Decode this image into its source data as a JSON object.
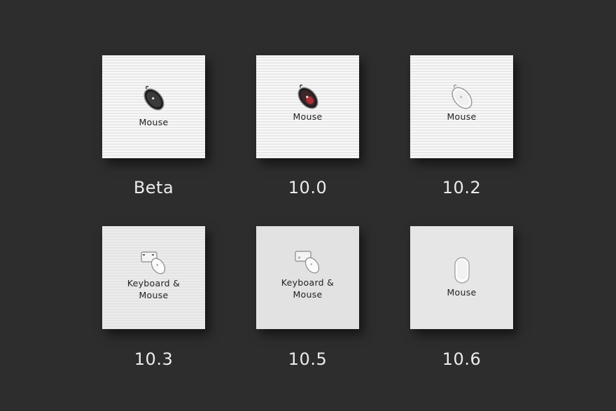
{
  "tiles": [
    {
      "label": "Mouse",
      "caption": "Beta",
      "icon": "dark-mouse-icon"
    },
    {
      "label": "Mouse",
      "caption": "10.0",
      "icon": "dark-red-mouse-icon"
    },
    {
      "label": "Mouse",
      "caption": "10.2",
      "icon": "white-mouse-icon"
    },
    {
      "label_line1": "Keyboard &",
      "label_line2": "Mouse",
      "caption": "10.3",
      "icon": "keyboard-mouse-icon"
    },
    {
      "label_line1": "Keyboard &",
      "label_line2": "Mouse",
      "caption": "10.5",
      "icon": "keyboard-mouse-icon"
    },
    {
      "label": "Mouse",
      "caption": "10.6",
      "icon": "magic-mouse-icon"
    }
  ]
}
